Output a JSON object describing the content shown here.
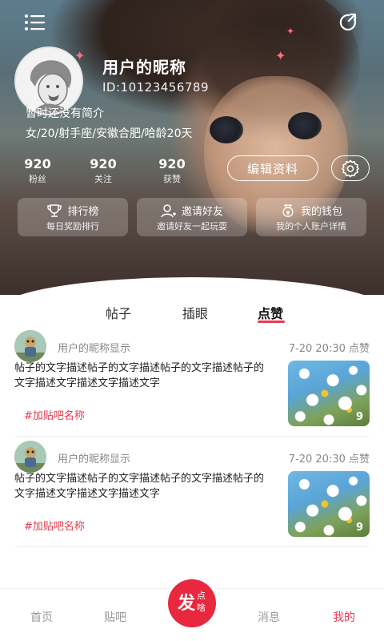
{
  "header": {
    "nickname": "用户的昵称",
    "user_id": "ID:10123456789",
    "bio": "暂时还没有简介",
    "tags": "女/20/射手座/安徽合肥/哈龄20天",
    "stats": [
      {
        "num": "920",
        "label": "粉丝"
      },
      {
        "num": "920",
        "label": "关注"
      },
      {
        "num": "920",
        "label": "获赞"
      }
    ],
    "edit_label": "编辑资料",
    "cards": [
      {
        "title": "排行榜",
        "sub": "每日奖励排行",
        "icon": "trophy-icon"
      },
      {
        "title": "邀请好友",
        "sub": "邀请好友一起玩耍",
        "icon": "invite-user-icon"
      },
      {
        "title": "我的钱包",
        "sub": "我的个人账户详情",
        "icon": "wallet-icon"
      }
    ]
  },
  "tabs": [
    {
      "label": "帖子"
    },
    {
      "label": "插眼"
    },
    {
      "label": "点赞"
    }
  ],
  "posts": [
    {
      "username": "用户的昵称显示",
      "time": "7-20 20:30 点赞",
      "text": "帖子的文字描述帖子的文字描述帖子的文字描述帖子的文字描述文字描述文字描述文字",
      "forum": "#加贴吧名称",
      "image_count": "9"
    },
    {
      "username": "用户的昵称显示",
      "time": "7-20 20:30 点赞",
      "text": "帖子的文字描述帖子的文字描述帖子的文字描述帖子的文字描述文字描述文字描述文字",
      "forum": "#加贴吧名称",
      "image_count": "9"
    }
  ],
  "bottom_nav": {
    "items": [
      {
        "label": "首页"
      },
      {
        "label": "贴吧"
      },
      {
        "label": "消息"
      },
      {
        "label": "我的"
      }
    ],
    "fab": {
      "big": "发",
      "small1": "点",
      "small2": "啥"
    }
  },
  "colors": {
    "accent": "#e83a50",
    "fab": "#e8283f"
  }
}
